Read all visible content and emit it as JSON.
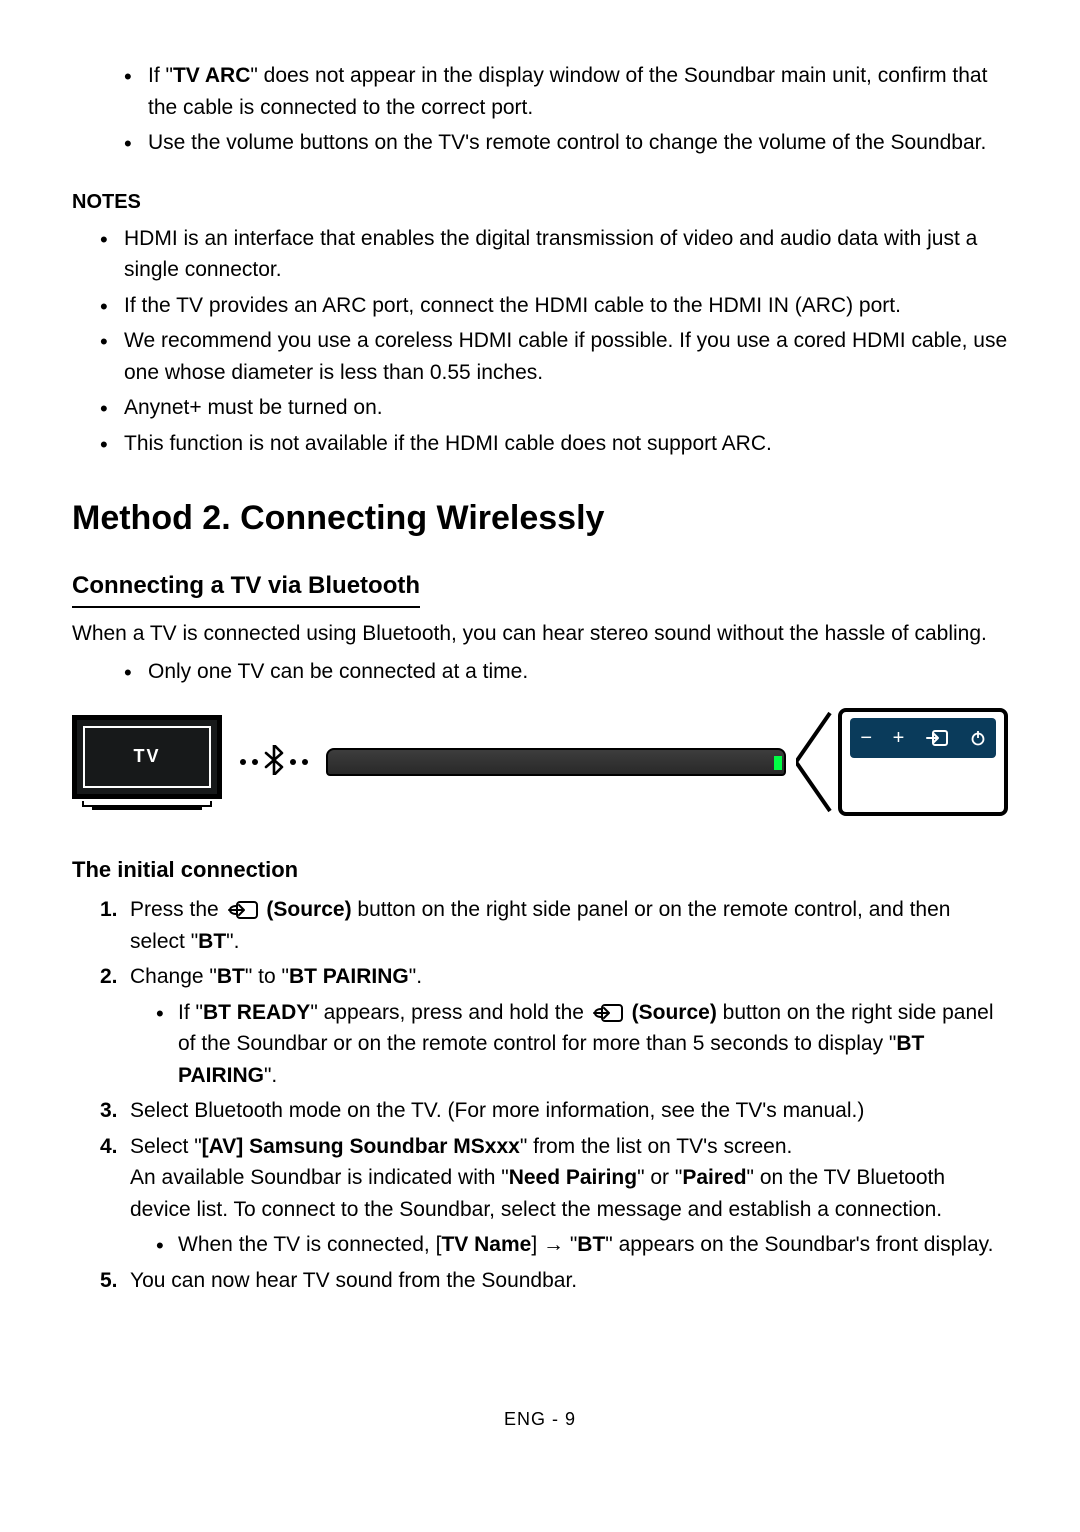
{
  "top": {
    "bullet1_pre": "If \"",
    "bullet1_strong": "TV ARC",
    "bullet1_post": "\" does not appear in the display window of the Soundbar main unit, confirm that the cable is connected to the correct port.",
    "bullet2": "Use the volume buttons on the TV's remote control to change the volume of the Soundbar."
  },
  "notes": {
    "heading": "NOTES",
    "items": {
      "n1": "HDMI is an interface that enables the digital transmission of video and audio data with just a single connector.",
      "n2": "If the TV provides an ARC port, connect the HDMI cable to the HDMI IN (ARC) port.",
      "n3": "We recommend you use a coreless HDMI cable if possible. If you use a cored HDMI cable, use one whose diameter is less than 0.55 inches.",
      "n4": "Anynet+ must be turned on.",
      "n5": "This function is not available if the HDMI cable does not support ARC."
    }
  },
  "method2": {
    "heading": "Method 2. Connecting Wirelessly",
    "bt_heading": "Connecting a TV via Bluetooth",
    "intro": "When a TV is connected using Bluetooth, you can hear stereo sound without the hassle of cabling.",
    "one_tv": "Only one TV can be connected at a time."
  },
  "diagram": {
    "tv_label": "TV",
    "panel_minus": "−",
    "panel_plus": "+"
  },
  "init": {
    "heading": "The initial connection",
    "s1": {
      "num": "1.",
      "pre": "Press the ",
      "src_label": " (Source)",
      "post1": " button on the right side panel or on the remote control, and then select \"",
      "bt": "BT",
      "post2": "\"."
    },
    "s2": {
      "num": "2.",
      "pre": "Change \"",
      "bt": "BT",
      "mid": "\" to \"",
      "pairing": "BT PAIRING",
      "post": "\".",
      "sub_pre": "If \"",
      "sub_ready": "BT READY",
      "sub_mid": "\" appears, press and hold the ",
      "sub_src_label": " (Source)",
      "sub_post1": " button on the right side panel of the Soundbar or on the remote control for more than 5 seconds to display \"",
      "sub_pairing": "BT PAIRING",
      "sub_post2": "\"."
    },
    "s3": {
      "num": "3.",
      "text": "Select Bluetooth mode on the TV. (For more information, see the TV's manual.)"
    },
    "s4": {
      "num": "4.",
      "pre": "Select \"",
      "av": "[AV] Samsung Soundbar MSxxx",
      "post": "\" from the list on TV's screen.",
      "line2_pre": "An available Soundbar is indicated with \"",
      "need": "Need Pairing",
      "line2_mid": "\" or \"",
      "paired": "Paired",
      "line2_post": "\" on the TV Bluetooth device list. To connect to the Soundbar, select the message and establish a connection.",
      "sub_pre": "When the TV is connected, [",
      "sub_tvname": "TV Name",
      "sub_mid": "] → \"",
      "sub_bt": "BT",
      "sub_post": "\" appears on the Soundbar's front display."
    },
    "s5": {
      "num": "5.",
      "text": "You can now hear TV sound from the Soundbar."
    }
  },
  "footer": "ENG - 9"
}
